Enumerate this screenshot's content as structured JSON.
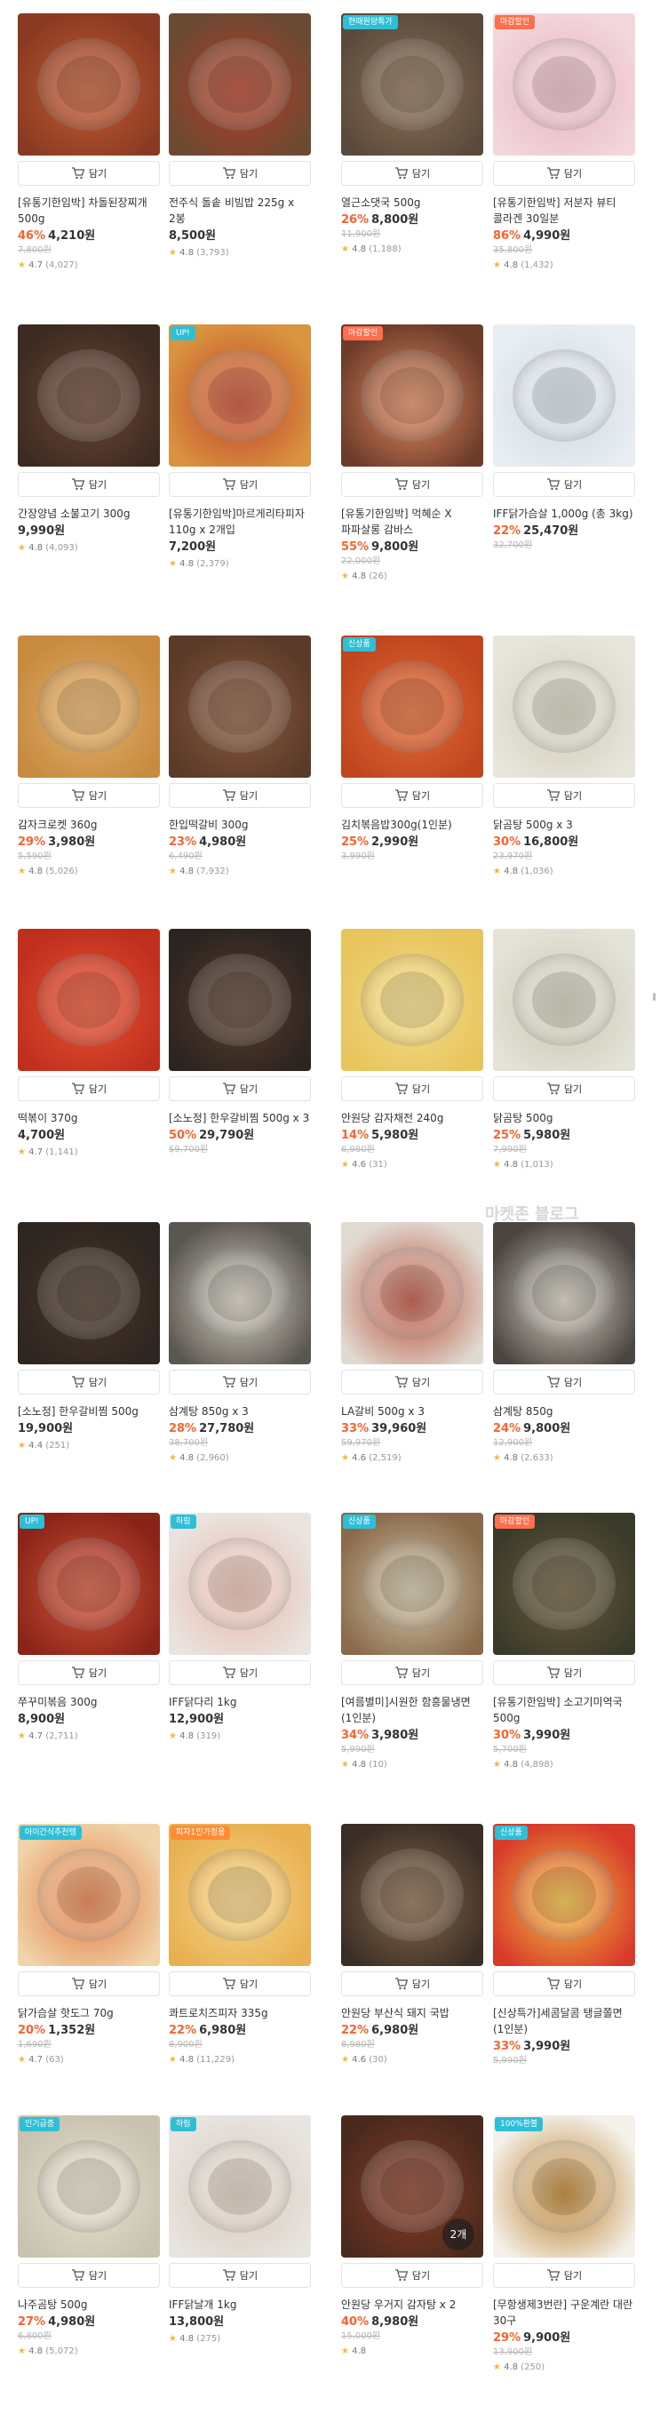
{
  "cart_label": "담기",
  "watermark": "마켓존 블로그",
  "colors": {
    "discount": "#fa622f",
    "star": "#fbb338",
    "badge_default": "#2ebfd6"
  },
  "products": [
    {
      "name": "[유통기한임박] 차돌된장찌개 500g",
      "rate": "46%",
      "price": "4,210원",
      "original": "7,800원",
      "score": "4.7",
      "reviews": "(4,027)",
      "badge": "",
      "image_icon": "stew-pot-photo"
    },
    {
      "name": "전주식 돌솥 비빔밥 225g x 2봉",
      "rate": "",
      "price": "8,500원",
      "original": "",
      "score": "4.8",
      "reviews": "(3,793)",
      "badge": "",
      "image_icon": "bibimbap-photo"
    },
    {
      "name": "열근소댓국 500g",
      "rate": "26%",
      "price": "8,800원",
      "original": "11,900원",
      "score": "4.8",
      "reviews": "(1,188)",
      "badge": "한때원양특가",
      "image_icon": "soup-photo"
    },
    {
      "name": "[유통기한임박] 저분자 뷰티 콜라겐 30일분",
      "rate": "86%",
      "price": "4,990원",
      "original": "35,800원",
      "score": "4.8",
      "reviews": "(1,432)",
      "badge": "마감할인",
      "image_icon": "collagen-box-photo"
    },
    {
      "name": "간장양념 소불고기 300g",
      "rate": "",
      "price": "9,990원",
      "original": "",
      "score": "4.8",
      "reviews": "(4,093)",
      "badge": "",
      "image_icon": "bulgogi-photo"
    },
    {
      "name": "[유통기한임박]마르게리타피자 110g x 2개입",
      "rate": "",
      "price": "7,200원",
      "original": "",
      "score": "4.8",
      "reviews": "(2,379)",
      "badge": "UP!",
      "image_icon": "pizza-photo"
    },
    {
      "name": "[유통기한임박] 먹혜순 X 파파살롱 감바스",
      "rate": "55%",
      "price": "9,800원",
      "original": "22,000원",
      "score": "4.8",
      "reviews": "(26)",
      "badge": "마감할인",
      "image_icon": "gambas-photo"
    },
    {
      "name": "IFF닭가슴살 1,000g (총 3kg)",
      "rate": "22%",
      "price": "25,470원",
      "original": "32,700원",
      "score": "",
      "reviews": "",
      "badge": "",
      "image_icon": "chicken-pack-photo"
    },
    {
      "name": "감자크로켓 360g",
      "rate": "29%",
      "price": "3,980원",
      "original": "5,590원",
      "score": "4.8",
      "reviews": "(5,026)",
      "badge": "",
      "image_icon": "croquette-photo"
    },
    {
      "name": "한입떡갈비 300g",
      "rate": "23%",
      "price": "4,980원",
      "original": "6,490원",
      "score": "4.8",
      "reviews": "(7,932)",
      "badge": "",
      "image_icon": "tteokgalbi-photo"
    },
    {
      "name": "김치볶음밥300g(1인분)",
      "rate": "25%",
      "price": "2,990원",
      "original": "3,990원",
      "score": "",
      "reviews": "",
      "badge": "신상품",
      "image_icon": "fried-rice-photo"
    },
    {
      "name": "닭곰탕 500g x 3",
      "rate": "30%",
      "price": "16,800원",
      "original": "23,970원",
      "score": "4.8",
      "reviews": "(1,036)",
      "badge": "",
      "image_icon": "chicken-soup-photo"
    },
    {
      "name": "떡볶이 370g",
      "rate": "",
      "price": "4,700원",
      "original": "",
      "score": "4.7",
      "reviews": "(1,141)",
      "badge": "",
      "image_icon": "tteokbokki-photo"
    },
    {
      "name": "[소노정] 한우갈비찜 500g x 3",
      "rate": "50%",
      "price": "29,790원",
      "original": "$9,700원",
      "score": "",
      "reviews": "",
      "badge": "",
      "image_icon": "galbijjim-photo"
    },
    {
      "name": "안원당 감자채전 240g",
      "rate": "14%",
      "price": "5,980원",
      "original": "6,980원",
      "score": "4.6",
      "reviews": "(31)",
      "badge": "",
      "image_icon": "potato-pancake-photo"
    },
    {
      "name": "닭곰탕 500g",
      "rate": "25%",
      "price": "5,980원",
      "original": "7,990원",
      "score": "4.8",
      "reviews": "(1,013)",
      "badge": "",
      "image_icon": "chicken-soup-photo"
    },
    {
      "name": "[소노정] 한우갈비찜 500g",
      "rate": "",
      "price": "19,900원",
      "original": "",
      "score": "4.4",
      "reviews": "(251)",
      "badge": "",
      "image_icon": "galbijjim-photo"
    },
    {
      "name": "삼계탕 850g x 3",
      "rate": "28%",
      "price": "27,780원",
      "original": "38,700원",
      "score": "4.8",
      "reviews": "(2,960)",
      "badge": "",
      "image_icon": "samgyetang-photo"
    },
    {
      "name": "LA갈비 500g x 3",
      "rate": "33%",
      "price": "39,960원",
      "original": "59,970원",
      "score": "4.6",
      "reviews": "(2,519)",
      "badge": "",
      "image_icon": "la-galbi-pack-photo"
    },
    {
      "name": "삼계탕 850g",
      "rate": "24%",
      "price": "9,800원",
      "original": "12,900원",
      "score": "4.8",
      "reviews": "(2,633)",
      "badge": "",
      "image_icon": "samgyetang-photo"
    },
    {
      "name": "쭈꾸미볶음 300g",
      "rate": "",
      "price": "8,900원",
      "original": "",
      "score": "4.7",
      "reviews": "(2,711)",
      "badge": "UP!",
      "image_icon": "jjukkumi-photo"
    },
    {
      "name": "IFF닭다리 1kg",
      "rate": "",
      "price": "12,900원",
      "original": "",
      "score": "4.8",
      "reviews": "(319)",
      "badge": "하림",
      "image_icon": "drumstick-photo"
    },
    {
      "name": "[여름별미]시원한 함흥물냉면(1인분)",
      "rate": "34%",
      "price": "3,980원",
      "original": "5,990원",
      "score": "4.8",
      "reviews": "(10)",
      "badge": "신상품",
      "image_icon": "naengmyeon-photo"
    },
    {
      "name": "[유통기한임박] 소고기미역국 500g",
      "rate": "30%",
      "price": "3,990원",
      "original": "5,700원",
      "score": "4.8",
      "reviews": "(4,898)",
      "badge": "마감할인",
      "image_icon": "seaweed-soup-photo"
    },
    {
      "name": "닭가슴살 핫도그 70g",
      "rate": "20%",
      "price": "1,352원",
      "original": "1,690원",
      "score": "4.7",
      "reviews": "(63)",
      "badge": "아이간식추천템",
      "image_icon": "hotdog-photo"
    },
    {
      "name": "콰트로치즈피자 335g",
      "rate": "22%",
      "price": "6,980원",
      "original": "8,900원",
      "score": "4.8",
      "reviews": "(11,229)",
      "badge": "피자1인가정용",
      "image_icon": "cheese-pizza-photo"
    },
    {
      "name": "안원당 부산식 돼지 국밥",
      "rate": "22%",
      "price": "6,980원",
      "original": "8,980원",
      "score": "4.6",
      "reviews": "(30)",
      "badge": "",
      "image_icon": "gukbap-photo"
    },
    {
      "name": "[신상특가]세콤달콤 탱글쫄면(1인분)",
      "rate": "33%",
      "price": "3,990원",
      "original": "5,990원",
      "score": "",
      "reviews": "",
      "badge": "신상품",
      "image_icon": "jjolmyeon-photo"
    },
    {
      "name": "나주곰탕 500g",
      "rate": "27%",
      "price": "4,980원",
      "original": "6,800원",
      "score": "4.8",
      "reviews": "(5,072)",
      "badge": "인기급증",
      "image_icon": "gomtang-photo"
    },
    {
      "name": "IFF닭날개 1kg",
      "rate": "",
      "price": "13,800원",
      "original": "",
      "score": "4.8",
      "reviews": "(275)",
      "badge": "하림",
      "image_icon": "chicken-wing-photo"
    },
    {
      "name": "안원당 우거지 감자탕 x 2",
      "rate": "40%",
      "price": "8,980원",
      "original": "15,000원",
      "score": "4.8",
      "reviews": "",
      "badge": "",
      "image_icon": "gamjatang-photo",
      "qty_badge": "2개"
    },
    {
      "name": "[무항생제3번란] 구운계란 대란 30구",
      "rate": "29%",
      "price": "9,900원",
      "original": "13,900원",
      "score": "4.8",
      "reviews": "(250)",
      "badge": "100%환불",
      "image_icon": "roasted-egg-photo"
    }
  ]
}
